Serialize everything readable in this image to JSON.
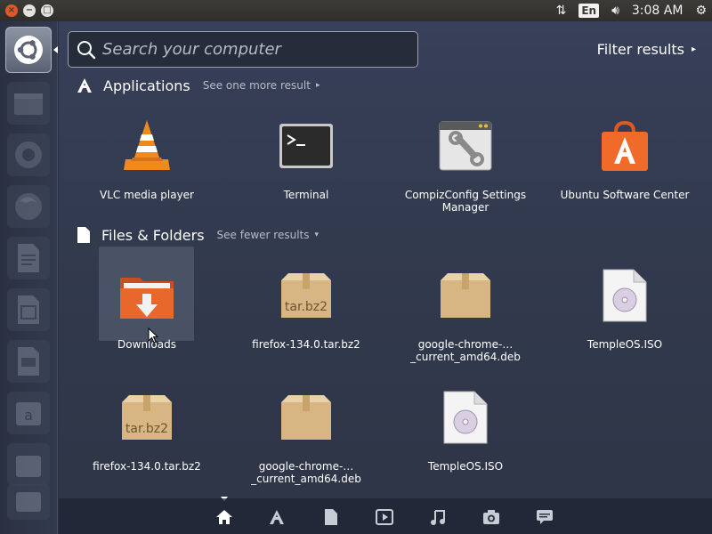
{
  "panel": {
    "window_buttons": [
      "close",
      "minimize",
      "maximize"
    ],
    "language": "En",
    "clock": "3:08 AM",
    "indicators": [
      "network-arrows-icon",
      "keyboard-language-indicator",
      "volume-icon",
      "power-gear-icon"
    ]
  },
  "search": {
    "placeholder": "Search your computer",
    "value": ""
  },
  "filter": {
    "label": "Filter results",
    "arrow": "▸"
  },
  "applications": {
    "title": "Applications",
    "more_label": "See one more result",
    "arrow": "▸",
    "items": [
      {
        "label": "VLC media player",
        "icon": "vlc-icon"
      },
      {
        "label": "Terminal",
        "icon": "terminal-icon"
      },
      {
        "label": "CompizConfig Settings Manager",
        "icon": "compizconfig-icon"
      },
      {
        "label": "Ubuntu Software Center",
        "icon": "software-center-icon"
      }
    ]
  },
  "files": {
    "title": "Files & Folders",
    "more_label": "See fewer results",
    "arrow": "▾",
    "items": [
      {
        "label": "Downloads",
        "icon": "downloads-folder-icon"
      },
      {
        "label": "firefox-134.0.tar.bz2",
        "icon": "archive-icon",
        "badge": "tar.bz2"
      },
      {
        "label": "google-chrome-…_current_amd64.deb",
        "icon": "package-icon"
      },
      {
        "label": "TempleOS.ISO",
        "icon": "disc-image-icon"
      },
      {
        "label": "firefox-134.0.tar.bz2",
        "icon": "archive-icon",
        "badge": "tar.bz2"
      },
      {
        "label": "google-chrome-…_current_amd64.deb",
        "icon": "package-icon"
      },
      {
        "label": "TempleOS.ISO",
        "icon": "disc-image-icon"
      }
    ]
  },
  "lenses": [
    "home-lens-icon",
    "applications-lens-icon",
    "files-lens-icon",
    "video-lens-icon",
    "music-lens-icon",
    "photo-lens-icon",
    "social-lens-icon"
  ],
  "colors": {
    "accent_orange": "#e0582a",
    "dash_bg": "#323a4f",
    "panel_bg": "#3c3b37"
  }
}
